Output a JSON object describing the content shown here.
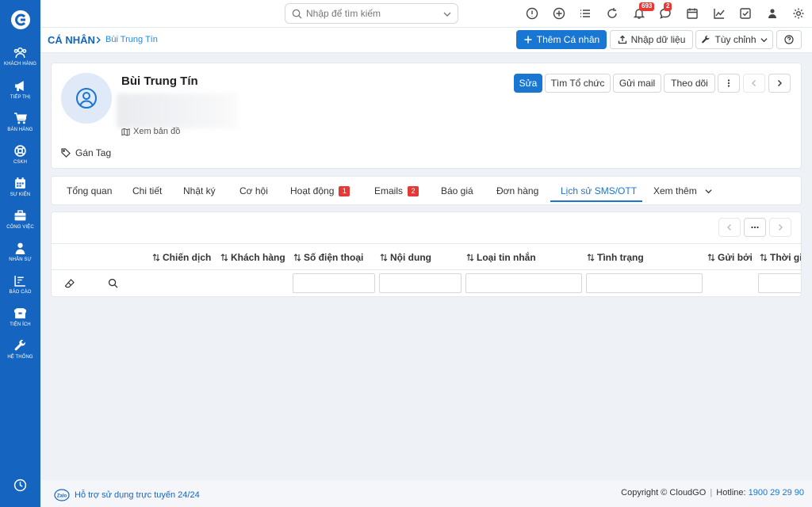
{
  "sidebar": {
    "items": [
      {
        "label": "KHÁCH HÀNG",
        "icon": "users-icon"
      },
      {
        "label": "TIẾP THỊ",
        "icon": "megaphone-icon"
      },
      {
        "label": "BÁN HÀNG",
        "icon": "cart-icon"
      },
      {
        "label": "CSKH",
        "icon": "lifebuoy-icon"
      },
      {
        "label": "SỰ KIỆN",
        "icon": "calendar-icon"
      },
      {
        "label": "CÔNG VIỆC",
        "icon": "briefcase-icon"
      },
      {
        "label": "NHÂN SỰ",
        "icon": "person-icon"
      },
      {
        "label": "BÁO CÁO",
        "icon": "report-icon"
      },
      {
        "label": "TIỆN ÍCH",
        "icon": "box-icon"
      },
      {
        "label": "HỆ THỐNG",
        "icon": "wrench-icon"
      }
    ]
  },
  "topbar": {
    "search_placeholder": "Nhập để tìm kiếm",
    "notifications_badge": "693",
    "chat_badge": "2"
  },
  "breadcrumb": {
    "root": "CÁ NHÂN",
    "current": "Bùi Trung Tín"
  },
  "actions": {
    "add": "Thêm Cá nhân",
    "import": "Nhập dữ liệu",
    "customize": "Tùy chỉnh"
  },
  "profile": {
    "name": "Bùi Trung Tín",
    "map_link": "Xem bản đồ",
    "tag_label": "Gán Tag",
    "buttons": {
      "edit": "Sửa",
      "find_org": "Tìm Tổ chức",
      "send_mail": "Gửi mail",
      "follow": "Theo dõi"
    }
  },
  "tabs": [
    {
      "label": "Tổng quan"
    },
    {
      "label": "Chi tiết"
    },
    {
      "label": "Nhật ký"
    },
    {
      "label": "Cơ hội"
    },
    {
      "label": "Hoạt động",
      "badge": "1"
    },
    {
      "label": "Emails",
      "badge": "2"
    },
    {
      "label": "Báo giá"
    },
    {
      "label": "Đơn hàng"
    },
    {
      "label": "Lịch sử SMS/OTT",
      "active": true
    },
    {
      "label": "Xem thêm"
    }
  ],
  "table": {
    "columns": [
      "Chiến dịch",
      "Khách hàng",
      "Số điện thoại",
      "Nội dung",
      "Loại tin nhắn",
      "Tình trạng",
      "Gửi bởi",
      "Thời gia"
    ]
  },
  "footer": {
    "support": "Hỗ trợ sử dụng trực tuyến 24/24",
    "copyright": "Copyright © CloudGO",
    "hotline_label": "Hotline:",
    "hotline": "1900 29 29 90"
  }
}
